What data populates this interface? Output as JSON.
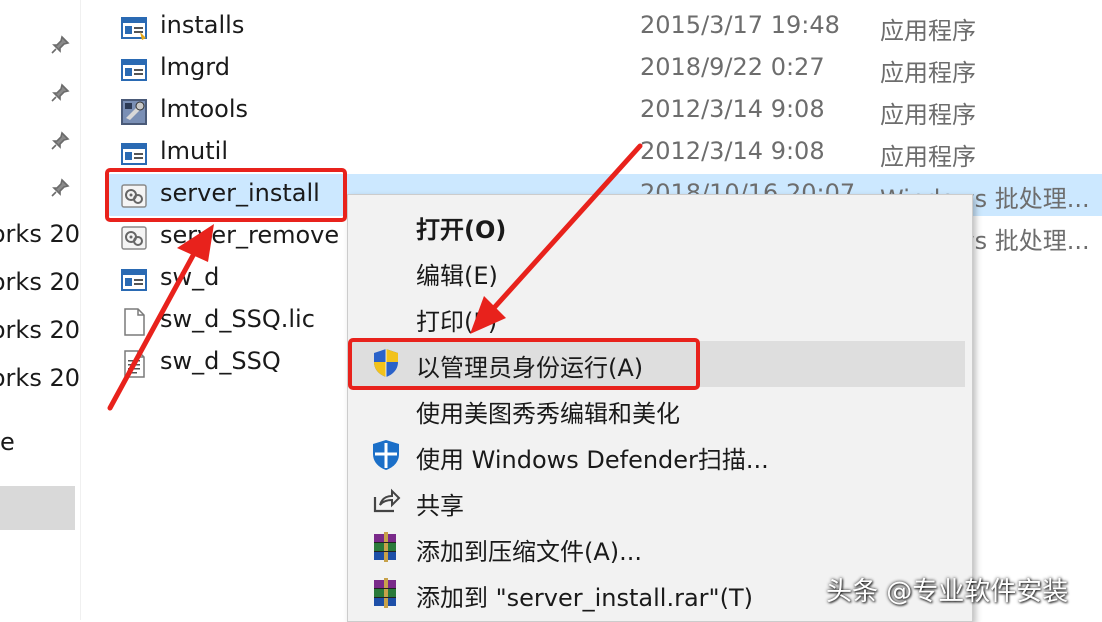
{
  "nav": {
    "items": [
      {
        "label": "orks 20"
      },
      {
        "label": "orks 20"
      },
      {
        "label": "orks 20"
      },
      {
        "label": "orks 20"
      },
      {
        "label": "e"
      }
    ]
  },
  "files": [
    {
      "name": "installs",
      "date": "2015/3/17 19:48",
      "type": "应用程序",
      "icon": "app-installer-icon"
    },
    {
      "name": "lmgrd",
      "date": "2018/9/22 0:27",
      "type": "应用程序",
      "icon": "exe-window-icon"
    },
    {
      "name": "lmtools",
      "date": "2012/3/14 9:08",
      "type": "应用程序",
      "icon": "tools-app-icon"
    },
    {
      "name": "lmutil",
      "date": "2012/3/14 9:08",
      "type": "应用程序",
      "icon": "exe-window-icon"
    },
    {
      "name": "server_install",
      "date": "2018/10/16 20:07",
      "type": "Windows 批处理...",
      "icon": "batch-gear-icon"
    },
    {
      "name": "server_remove",
      "date": "",
      "type": "Windows 批处理...",
      "icon": "batch-gear-icon"
    },
    {
      "name": "sw_d",
      "date": "",
      "type": "",
      "icon": "exe-window-icon"
    },
    {
      "name": "sw_d_SSQ.lic",
      "date": "",
      "type": "",
      "icon": "blank-file-icon"
    },
    {
      "name": "sw_d_SSQ",
      "date": "",
      "type": "",
      "icon": "text-file-icon"
    }
  ],
  "context_menu": {
    "items": [
      {
        "label": "打开(O)",
        "icon": ""
      },
      {
        "label": "编辑(E)",
        "icon": ""
      },
      {
        "label": "打印(P)",
        "icon": ""
      },
      {
        "label": "以管理员身份运行(A)",
        "icon": "uac-shield-icon"
      },
      {
        "label": "使用美图秀秀编辑和美化",
        "icon": ""
      },
      {
        "label": "使用 Windows Defender扫描...",
        "icon": "defender-shield-icon"
      },
      {
        "label": "共享",
        "icon": "share-icon"
      },
      {
        "label": "添加到压缩文件(A)...",
        "icon": "winrar-icon"
      },
      {
        "label": "添加到 \"server_install.rar\"(T)",
        "icon": "winrar-icon"
      }
    ]
  },
  "watermark": "头条 @专业软件安装",
  "colors": {
    "annotation": "#e8221c",
    "selection": "#cce8ff",
    "menu_bg": "#f2f2f2"
  }
}
